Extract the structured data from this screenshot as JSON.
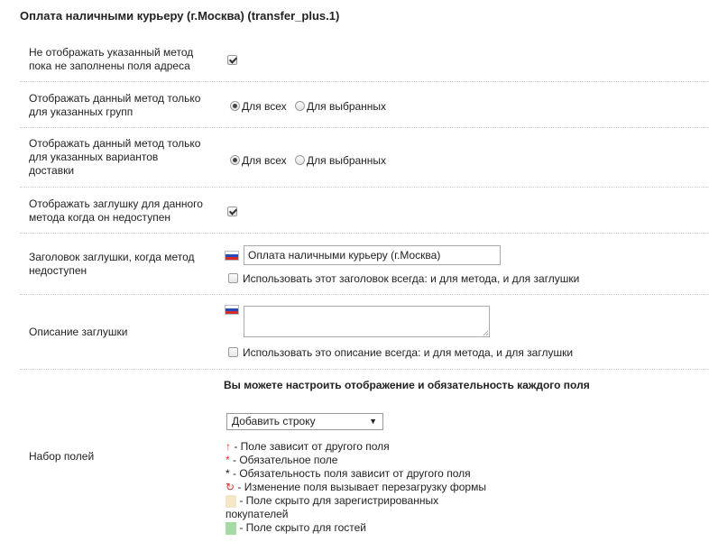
{
  "page_title": "Оплата наличными курьеру (г.Москва) (transfer_plus.1)",
  "colors": {
    "flag_white": "#ffffff",
    "flag_blue": "#2b49b6",
    "flag_red": "#d52b2b",
    "hidden_registered": "#f5e6c8",
    "hidden_guests": "#a6dba6",
    "marker_red": "#e03030"
  },
  "rows": {
    "hide_until_address": {
      "label_line1": "Не отображать указанный метод",
      "label_line2": "пока не заполнены поля адреса",
      "checked": true
    },
    "groups": {
      "label_line1": "Отображать данный метод только",
      "label_line2": "для указанных групп",
      "opt_all": "Для всех",
      "opt_selected": "Для выбранных",
      "selected": "all"
    },
    "delivery": {
      "label_line1": "Отображать данный метод только",
      "label_line2": "для указанных вариантов",
      "label_line3": "доставки",
      "opt_all": "Для всех",
      "opt_selected": "Для выбранных",
      "selected": "all"
    },
    "stub": {
      "label_line1": "Отображать заглушку для данного",
      "label_line2": "метода когда он недоступен",
      "checked": true
    },
    "stub_title": {
      "label_line1": "Заголовок заглушки, когда метод",
      "label_line2": "недоступен",
      "value": "Оплата наличными курьеру (г.Москва)",
      "always_label": "Использовать этот заголовок всегда: и для метода, и для заглушки",
      "always_checked": false
    },
    "stub_desc": {
      "label": "Описание заглушки",
      "value": "",
      "always_label": "Использовать это описание всегда: и для метода, и для заглушки",
      "always_checked": false
    },
    "fields": {
      "label": "Набор полей",
      "heading": "Вы можете настроить отображение и обязательность каждого поля",
      "select_value": "Добавить строку",
      "legend": {
        "depends": "- Поле зависит от другого поля",
        "required": "- Обязательное поле",
        "required_depends": "- Обязательность поля зависит от другого поля",
        "reload": "- Изменение поля вызывает перезагрузку формы",
        "hidden_registered_1": "- Поле скрыто для зарегистрированных",
        "hidden_registered_2": "покупателей",
        "hidden_guests": "- Поле скрыто для гостей"
      },
      "symbols": {
        "depends": "↑",
        "required": "*",
        "required_depends": "*",
        "reload": "↻"
      }
    }
  }
}
